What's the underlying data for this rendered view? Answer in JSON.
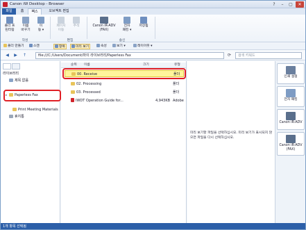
{
  "window": {
    "title": "Canon iW Desktop - Browser"
  },
  "window_controls": [
    "?",
    "–",
    "▢",
    "✕"
  ],
  "ribbon_tabs": [
    {
      "label": "파일"
    },
    {
      "label": "홈"
    },
    {
      "label": "팩스"
    },
    {
      "label": "오브젝트 편집"
    }
  ],
  "ribbon": {
    "buttons": [
      {
        "label": "폴더 프\n린터링"
      },
      {
        "label": "이름\n바꾸기"
      },
      {
        "label": "이\n동 ▾"
      },
      {
        "label": "페이지\n이동"
      },
      {
        "label": "주석"
      },
      {
        "label": "Canon iR-ADV\n(FAX)"
      },
      {
        "label": "전자\n패킹 ▾"
      },
      {
        "label": "저장됨"
      }
    ],
    "groups": [
      "작성",
      "편집",
      "송신"
    ]
  },
  "toolbar": {
    "items": [
      {
        "label": "폴더 만들기"
      },
      {
        "label": "스캔"
      },
      {
        "label": "항목"
      },
      {
        "label": "미리 보기"
      },
      {
        "label": "속성"
      },
      {
        "label": "보기 ▾"
      },
      {
        "label": "레이아웃 ▾"
      }
    ]
  },
  "address": {
    "path": "file:///C:/Users/Document/마이 라이브러리/Paperless Fax",
    "search_placeholder": "검색 키워드"
  },
  "library": {
    "title": "라이브러리",
    "tree": [
      {
        "label": "제목 없음",
        "expand": ""
      },
      {
        "label": "Paperless Fax",
        "expand": "▸"
      },
      {
        "label": "Print Meeting Materials",
        "expand": ""
      },
      {
        "label": "휴지통",
        "expand": ""
      }
    ]
  },
  "file_list": {
    "columns": {
      "rank": "순위",
      "name": "이름",
      "size": "크기",
      "type": "유형"
    },
    "rows": [
      {
        "name": "00. Receive",
        "size": "",
        "type": "폴더",
        "icon": "folder"
      },
      {
        "name": "02. Processing",
        "size": "",
        "type": "폴더",
        "icon": "folder"
      },
      {
        "name": "03. Processed",
        "size": "",
        "type": "폴더",
        "icon": "folder"
      },
      {
        "name": "IWDT Operation Guide for...",
        "size": "4,943KB",
        "type": "Adobe ...",
        "icon": "pdf"
      }
    ]
  },
  "preview": {
    "message": "미리 보기할 파일을 선택하십시오. 미리 보기가 표시되지 않으면 파일을 다시 선택하십시오."
  },
  "side_buttons": [
    {
      "label": "인쇄 설정"
    },
    {
      "label": "전자 패킹"
    },
    {
      "label": "Canon iR-ADV"
    },
    {
      "label": "Canon iR-ADV\n(FAX)"
    }
  ],
  "status": {
    "text": "1개 항목 선택됨"
  },
  "colors": {
    "accent": "#2c5fa8",
    "highlight_ring": "#e01f25",
    "selected_row": "#fff59b"
  }
}
